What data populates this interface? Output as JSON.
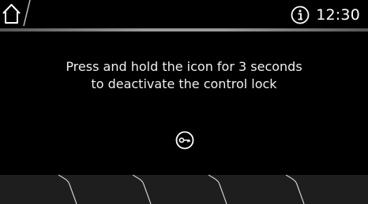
{
  "status_bar": {
    "time": "12:30",
    "icons": [
      "home-icon",
      "info-icon"
    ]
  },
  "message": {
    "line1": "Press and hold the icon for 3 seconds",
    "line2": "to deactivate the control lock"
  },
  "control_lock": {
    "icon": "key-icon"
  },
  "soft_keys": {
    "count": 5
  }
}
